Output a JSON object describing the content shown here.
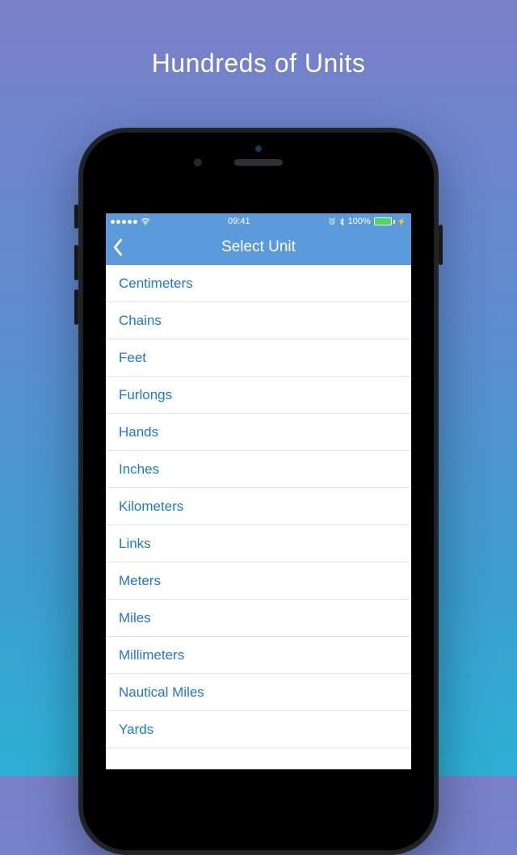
{
  "hero": {
    "title": "Hundreds of Units"
  },
  "status": {
    "time": "09:41",
    "battery_pct": "100%"
  },
  "nav": {
    "title": "Select Unit"
  },
  "units": [
    "Centimeters",
    "Chains",
    "Feet",
    "Furlongs",
    "Hands",
    "Inches",
    "Kilometers",
    "Links",
    "Meters",
    "Miles",
    "Millimeters",
    "Nautical Miles",
    "Yards"
  ],
  "colors": {
    "nav_bg": "#5b9bdc",
    "link": "#1e77d3",
    "bg_top": "#7a7fc8",
    "bg_bottom": "#2db0d6"
  }
}
